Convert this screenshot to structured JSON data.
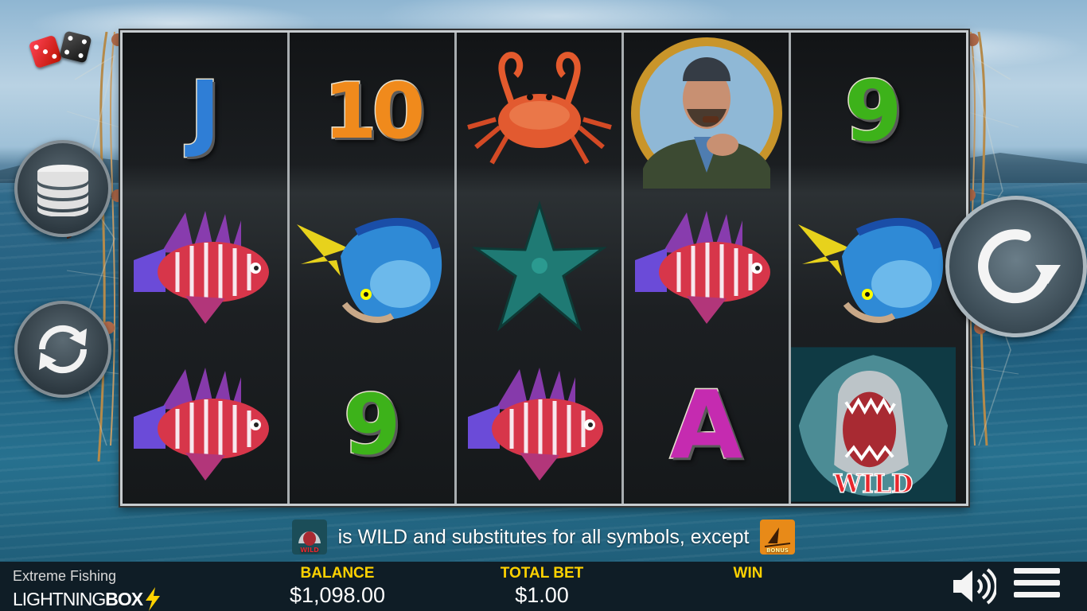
{
  "game": {
    "title": "Extreme Fishing",
    "brand_main": "LIGHTNING",
    "brand_box": "BOX"
  },
  "reels": [
    [
      "J",
      "lionfish-symbol",
      "lionfish-symbol"
    ],
    [
      "10",
      "mahi-mahi-symbol",
      "9"
    ],
    [
      "crab-symbol",
      "starfish-symbol",
      "lionfish-symbol"
    ],
    [
      "fisherman-symbol",
      "lionfish-symbol",
      "A"
    ],
    [
      "9",
      "mahi-mahi-symbol",
      "shark-wild-symbol"
    ]
  ],
  "symbols": {
    "j": "J",
    "ten": "10",
    "nine": "9",
    "ace": "A",
    "wild_label": "WILD",
    "bonus_label": "BONUS"
  },
  "info_text": "is WILD and substitutes for all symbols, except",
  "bar": {
    "balance_label": "BALANCE",
    "balance_value": "$1,098.00",
    "bet_label": "TOTAL BET",
    "bet_value": "$1.00",
    "win_label": "WIN",
    "win_value": ""
  },
  "colors": {
    "accent_yellow": "#ffd200",
    "bar_bg": "#0e1820"
  },
  "icons": [
    "dice-logo-icon",
    "coins-icon",
    "autoplay-icon",
    "spin-icon",
    "speaker-icon",
    "menu-icon",
    "lightning-bolt-icon"
  ]
}
